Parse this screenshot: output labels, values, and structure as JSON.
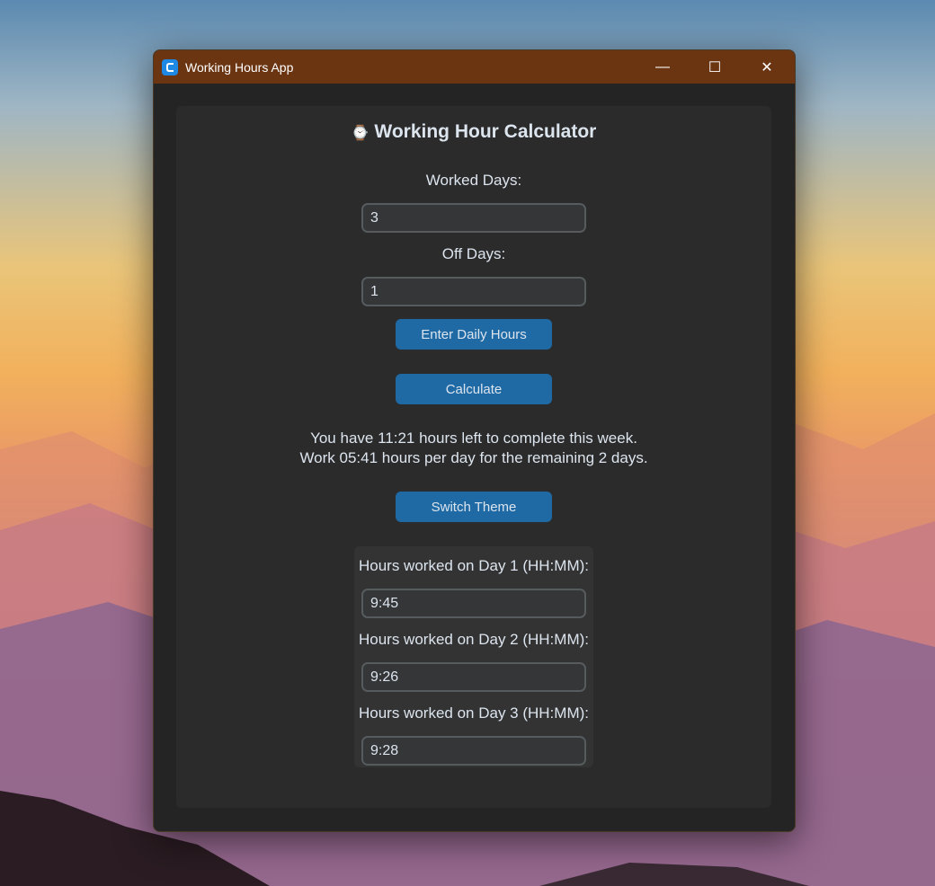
{
  "window": {
    "title": "Working Hours App"
  },
  "titlebar": {
    "minimize": "—",
    "maximize": "☐",
    "close": "✕"
  },
  "app": {
    "heading_icon": "⌚",
    "heading": "Working Hour Calculator",
    "worked_days_label": "Worked Days:",
    "worked_days_value": "3",
    "off_days_label": "Off Days:",
    "off_days_value": "1",
    "enter_daily_hours_button": "Enter Daily Hours",
    "calculate_button": "Calculate",
    "result_line1": "You have 11:21 hours left to complete this week.",
    "result_line2": "Work 05:41 hours per day for the remaining 2 days.",
    "switch_theme_button": "Switch Theme"
  },
  "daily_hours": [
    {
      "label": "Hours worked on Day 1 (HH:MM):",
      "value": "9:45"
    },
    {
      "label": "Hours worked on Day 2 (HH:MM):",
      "value": "9:26"
    },
    {
      "label": "Hours worked on Day 3 (HH:MM):",
      "value": "9:28"
    }
  ],
  "colors": {
    "titlebar": "#6b3512",
    "button": "#1f6aa5",
    "panel": "#2b2b2b",
    "window": "#242424"
  }
}
